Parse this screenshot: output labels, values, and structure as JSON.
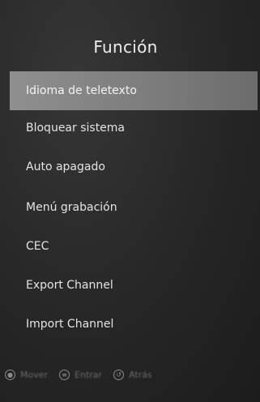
{
  "header": {
    "title": "Función"
  },
  "menu": {
    "items": [
      {
        "label": "Idioma de teletexto"
      },
      {
        "label": "Bloquear sistema"
      },
      {
        "label": "Auto apagado"
      },
      {
        "label": "Menú grabación"
      },
      {
        "label": "CEC"
      },
      {
        "label": "Export Channel"
      },
      {
        "label": "Import Channel"
      }
    ]
  },
  "footer": {
    "hints": [
      {
        "icon": "ok-icon",
        "label": "Mover"
      },
      {
        "icon": "menu-icon",
        "label": "Entrar"
      },
      {
        "icon": "back-icon",
        "label": "Atrás"
      }
    ]
  }
}
